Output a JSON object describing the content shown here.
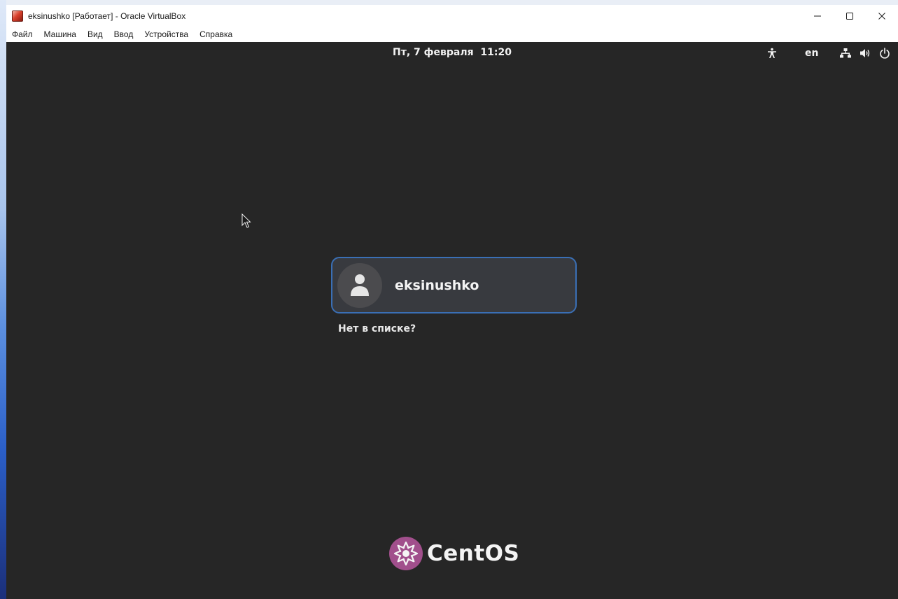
{
  "window": {
    "title": "eksinushko [Работает] - Oracle VirtualBox",
    "app_icon": "virtualbox-icon",
    "controls": [
      "minimize-icon",
      "maximize-icon",
      "close-icon"
    ]
  },
  "menubar": {
    "items": [
      {
        "label": "Файл"
      },
      {
        "label": "Машина"
      },
      {
        "label": "Вид"
      },
      {
        "label": "Ввод"
      },
      {
        "label": "Устройства"
      },
      {
        "label": "Справка"
      }
    ]
  },
  "topbar": {
    "datetime": "Пт, 7 февраля  11:20",
    "language": "en",
    "icons": [
      "accessibility-icon",
      "network-icon",
      "volume-icon",
      "power-icon"
    ]
  },
  "login": {
    "user_name": "eksinushko",
    "avatar_icon": "user-avatar-icon",
    "not_listed": "Нет в списке?"
  },
  "branding": {
    "name": "CentOS",
    "logo_color": "#a14f8c"
  },
  "colors": {
    "screen_bg": "#262626",
    "card_bg": "#383a3f",
    "card_border": "#3a6fb5"
  }
}
